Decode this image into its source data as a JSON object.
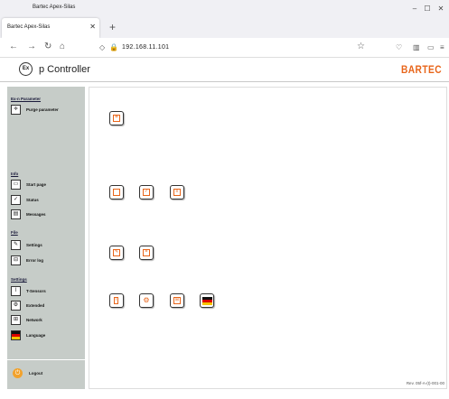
{
  "window": {
    "title": "Bartec Apex-Silas"
  },
  "tab": {
    "title": "Bartec Apex-Silas"
  },
  "nav": {
    "host": "192.168.11.101"
  },
  "app": {
    "title": "p Controller",
    "brand": "BARTEC",
    "ex_badge": "Ex"
  },
  "sidebar": {
    "sections": [
      {
        "label": "Ex-n Parameter",
        "items": [
          {
            "label": "Purge parameter",
            "icon": "purge-icon"
          }
        ]
      },
      {
        "label": "Info",
        "items": [
          {
            "label": "Start page",
            "icon": "window-icon"
          },
          {
            "label": "Status",
            "icon": "clipboard-icon"
          },
          {
            "label": "Messages",
            "icon": "messages-icon"
          }
        ]
      },
      {
        "label": "File",
        "items": [
          {
            "label": "Settings",
            "icon": "edit-icon"
          },
          {
            "label": "Error log",
            "icon": "error-log-icon"
          }
        ]
      },
      {
        "label": "Settings",
        "items": [
          {
            "label": "T-Sensors",
            "icon": "thermometer-icon"
          },
          {
            "label": "Extended",
            "icon": "gears-icon"
          },
          {
            "label": "Network",
            "icon": "network-icon"
          },
          {
            "label": "Language",
            "icon": "flag-icon"
          }
        ]
      }
    ],
    "logout": "Logout"
  },
  "footer": {
    "revision": "Rev. 05f-A-(t)-001-00"
  },
  "colors": {
    "brand": "#e8651a",
    "sidebar": "#c6ccc8",
    "logout": "#f2a22d"
  }
}
